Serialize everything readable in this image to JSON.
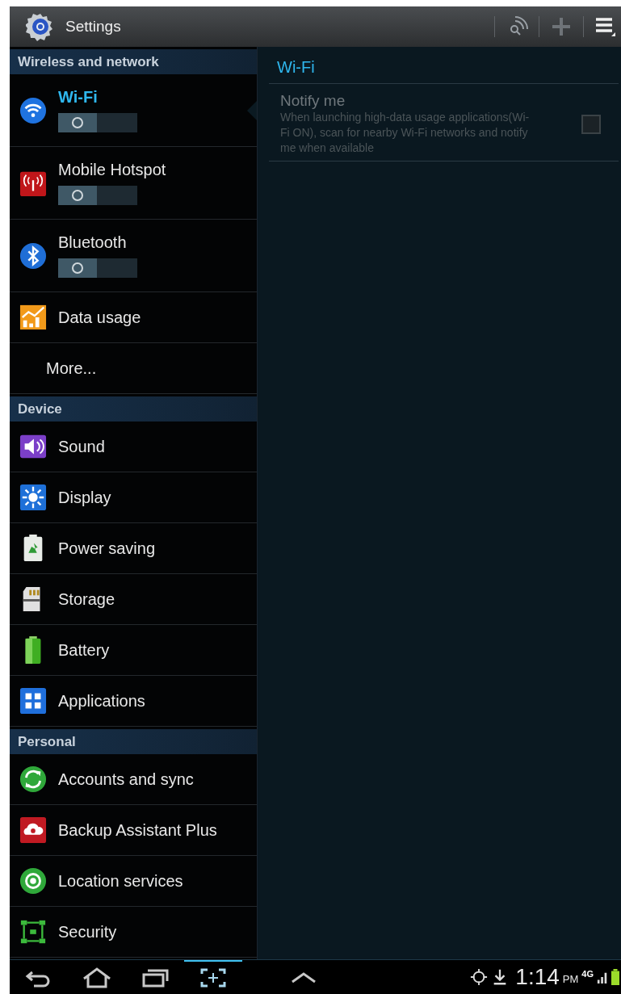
{
  "action_bar": {
    "title": "Settings"
  },
  "sidebar": {
    "sections": [
      {
        "title": "Wireless and network",
        "items": [
          {
            "kind": "toggle",
            "label": "Wi-Fi",
            "selected": true,
            "on": false
          },
          {
            "kind": "toggle",
            "label": "Mobile Hotspot",
            "selected": false,
            "on": false
          },
          {
            "kind": "toggle",
            "label": "Bluetooth",
            "selected": false,
            "on": false
          },
          {
            "kind": "item",
            "label": "Data usage",
            "selected": false
          },
          {
            "kind": "plain",
            "label": "More...",
            "selected": false
          }
        ]
      },
      {
        "title": "Device",
        "items": [
          {
            "kind": "item",
            "label": "Sound",
            "selected": false
          },
          {
            "kind": "item",
            "label": "Display",
            "selected": false
          },
          {
            "kind": "item",
            "label": "Power saving",
            "selected": false
          },
          {
            "kind": "item",
            "label": "Storage",
            "selected": false
          },
          {
            "kind": "item",
            "label": "Battery",
            "selected": false
          },
          {
            "kind": "item",
            "label": "Applications",
            "selected": false
          }
        ]
      },
      {
        "title": "Personal",
        "items": [
          {
            "kind": "item",
            "label": "Accounts and sync",
            "selected": false
          },
          {
            "kind": "item",
            "label": "Backup Assistant Plus",
            "selected": false
          },
          {
            "kind": "item",
            "label": "Location services",
            "selected": false
          },
          {
            "kind": "item",
            "label": "Security",
            "selected": false
          }
        ]
      }
    ]
  },
  "detail": {
    "title": "Wi-Fi",
    "settings": [
      {
        "title": "Notify me",
        "summary": "When launching high-data usage applications(Wi-Fi ON), scan for nearby Wi-Fi networks and notify me when available",
        "checked": false,
        "disabled": true
      }
    ]
  },
  "system_bar": {
    "nav": [
      {
        "kind": "back",
        "selected": false
      },
      {
        "kind": "home",
        "selected": false
      },
      {
        "kind": "recent",
        "selected": false
      },
      {
        "kind": "capture",
        "selected": true
      },
      {
        "kind": "up",
        "selected": false
      }
    ],
    "time": "1:14",
    "ampm": "PM",
    "network": "4G"
  }
}
